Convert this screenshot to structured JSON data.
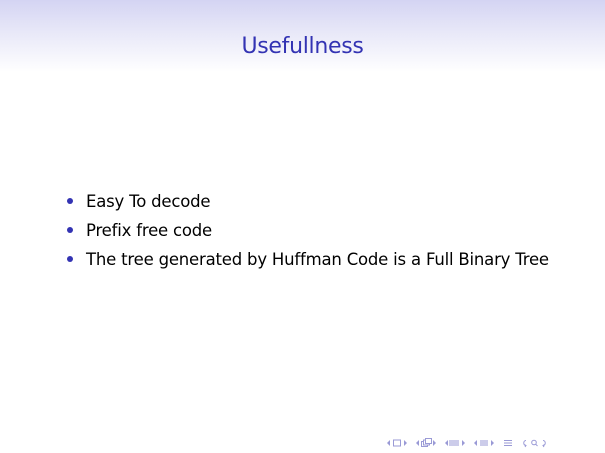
{
  "slide": {
    "title": "Usefullness",
    "bullets": [
      "Easy To decode",
      "Prefix free code",
      "The tree generated by Huffman Code is a Full Binary Tree"
    ]
  },
  "navigation": {
    "icons": [
      "nav-slide-prev-icon",
      "nav-slide-icon",
      "nav-slide-next-icon",
      "nav-frame-prev-icon",
      "nav-frame-icon",
      "nav-frame-next-icon",
      "nav-subsection-prev-icon",
      "nav-subsection-icon",
      "nav-subsection-next-icon",
      "nav-section-prev-icon",
      "nav-section-icon",
      "nav-section-next-icon",
      "nav-align-icon",
      "nav-search-back-forward-icon"
    ]
  },
  "colors": {
    "title": "#3333b3",
    "bullet": "#3333b3",
    "text": "#000000",
    "nav": "#9a9ad6",
    "title_band_top": "#d4d4f3"
  }
}
